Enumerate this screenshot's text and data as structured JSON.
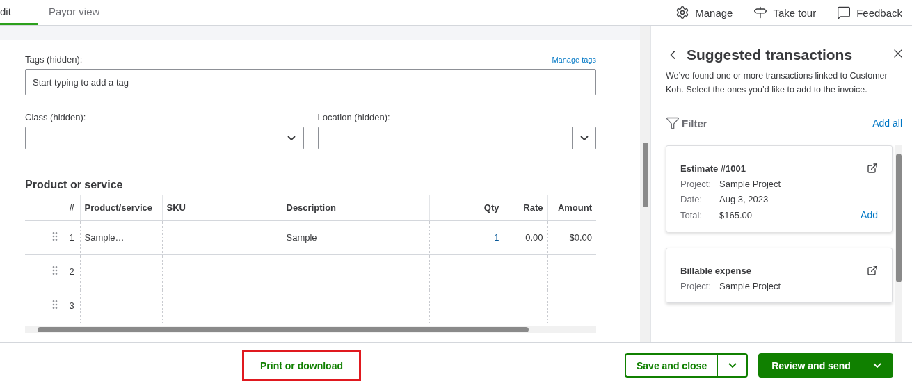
{
  "tabs": [
    {
      "label": "dit",
      "selected": true
    },
    {
      "label": "Payor view",
      "selected": false
    }
  ],
  "toolbar": [
    {
      "label": "Manage",
      "kind": "gear"
    },
    {
      "label": "Take tour",
      "kind": "signpost"
    },
    {
      "label": "Feedback",
      "kind": "message"
    }
  ],
  "form": {
    "tags": {
      "label": "Tags (hidden):",
      "link": "Manage tags",
      "placeholder": "Start typing to add a tag"
    },
    "selects": [
      {
        "label": "Class (hidden):"
      },
      {
        "label": "Location (hidden):"
      }
    ],
    "section_title": "Product or service"
  },
  "table": {
    "columns": [
      {
        "label": "#"
      },
      {
        "label": "Product/service"
      },
      {
        "label": "SKU"
      },
      {
        "label": "Description"
      },
      {
        "label": "Qty"
      },
      {
        "label": "Rate"
      },
      {
        "label": "Amount"
      }
    ],
    "rows": [
      {
        "cells": [
          "1",
          "Sample…",
          "",
          "Sample",
          "1",
          "0.00",
          "$0.00"
        ]
      },
      {
        "cells": [
          "2",
          "",
          "",
          "",
          "",
          "",
          ""
        ]
      },
      {
        "cells": [
          "3",
          "",
          "",
          "",
          "",
          "",
          ""
        ]
      }
    ]
  },
  "panel": {
    "title": "Suggested transactions",
    "description": "We’ve found one or more transactions linked to Customer Koh. Select the ones you’d like to add to the invoice.",
    "filter": "Filter",
    "add_all": "Add all",
    "cards": [
      {
        "title": "Estimate #1001",
        "fields": [
          {
            "label": "Project:",
            "value": "Sample Project"
          },
          {
            "label": "Date:",
            "value": "Aug 3, 2023"
          },
          {
            "label": "Total:",
            "value": "$165.00"
          }
        ],
        "action": "Add"
      },
      {
        "title": "Billable expense",
        "fields": [
          {
            "label": "Project:",
            "value": "Sample Project"
          }
        ]
      }
    ]
  },
  "footer": {
    "print": {
      "label": "Print or download",
      "highlighted": true
    },
    "save": "Save and close",
    "send": "Review and send"
  }
}
